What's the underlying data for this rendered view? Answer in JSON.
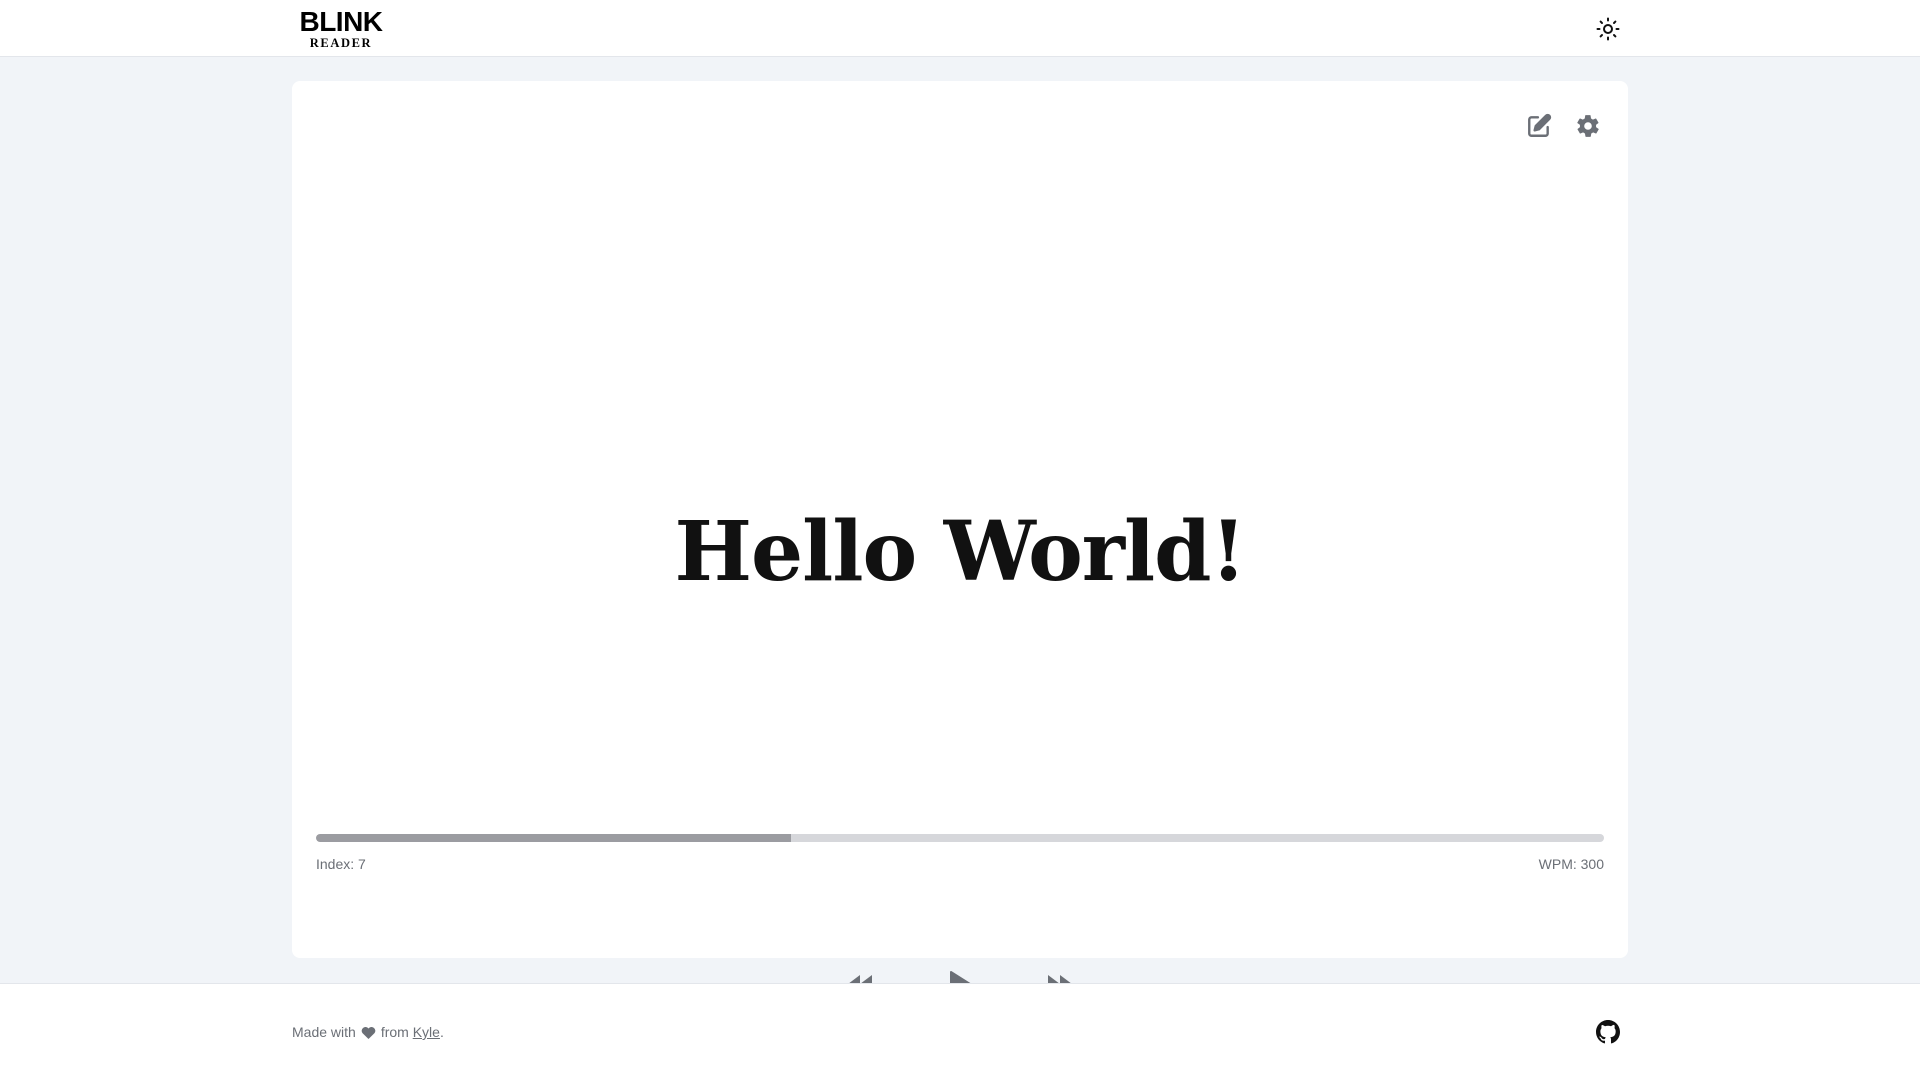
{
  "header": {
    "logo_main": "BLINK",
    "logo_sub": "READER",
    "theme_toggle_icon": "sun-icon"
  },
  "reader": {
    "word": "Hello World!",
    "progress_fraction": 0.369,
    "index_label": "Index: 7",
    "wpm_label": "WPM: 300",
    "tools": {
      "edit_icon": "edit-icon",
      "settings_icon": "gear-icon"
    },
    "controls": {
      "rewind_icon": "rewind-icon",
      "play_icon": "play-icon",
      "forward_icon": "fast-forward-icon"
    }
  },
  "footer": {
    "made_with": "Made with",
    "from": "from",
    "author": "Kyle",
    "period": ".",
    "github_icon": "github-icon"
  },
  "colors": {
    "background": "#f1f4f8",
    "icon_gray": "#6b6f76",
    "progress_fill": "#9b9ca1",
    "progress_track": "#d6d7db"
  }
}
